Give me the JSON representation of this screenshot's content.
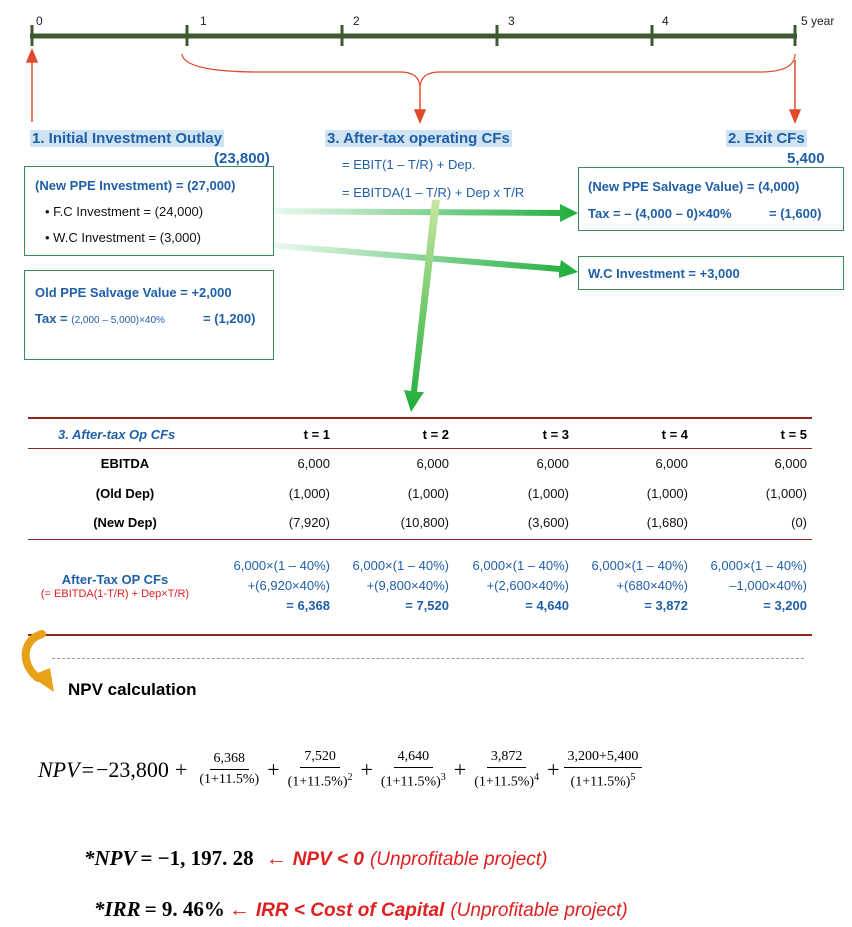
{
  "timeline": {
    "ticks": [
      "0",
      "1",
      "2",
      "3",
      "4",
      "5 year"
    ]
  },
  "initial": {
    "title": "1. Initial Investment Outlay",
    "amount": "(23,800)",
    "box1": {
      "line1": "(New PPE Investment) = (27,000)",
      "bullet1": "F.C Investment = (24,000)",
      "bullet2": "W.C Investment = (3,000)"
    },
    "box2": {
      "line1": "Old PPE Salvage Value = +2,000",
      "tax_label": "Tax = ",
      "tax_formula": "(2,000 – 5,000)×40%",
      "tax_value": "= (1,200)"
    }
  },
  "operating": {
    "title": "3. After-tax operating CFs",
    "formula1": "= EBIT(1 – T/R) + Dep.",
    "formula2": "= EBITDA(1 – T/R) + Dep x T/R"
  },
  "exit": {
    "title": "2. Exit CFs",
    "amount": "5,400",
    "box1": {
      "line1": "(New PPE Salvage Value) = (4,000)",
      "tax_label": "Tax = – (4,000 – 0)×40%",
      "tax_value": "= (1,600)"
    },
    "box2": {
      "line1": "W.C Investment = +3,000"
    }
  },
  "table": {
    "title": "3. After-tax Op CFs",
    "headers": [
      "t = 1",
      "t = 2",
      "t = 3",
      "t = 4",
      "t = 5"
    ],
    "rows": [
      {
        "label": "EBITDA",
        "values": [
          "6,000",
          "6,000",
          "6,000",
          "6,000",
          "6,000"
        ]
      },
      {
        "label": "(Old Dep)",
        "values": [
          "(1,000)",
          "(1,000)",
          "(1,000)",
          "(1,000)",
          "(1,000)"
        ]
      },
      {
        "label": "(New Dep)",
        "values": [
          "(7,920)",
          "(10,800)",
          "(3,600)",
          "(1,680)",
          "(0)"
        ]
      }
    ],
    "cf_label": "After-Tax OP CFs",
    "cf_sublabel": "(= EBITDA(1-T/R) + Dep×T/R)",
    "cf_calcs": [
      {
        "l1": "6,000×(1 – 40%)",
        "l2": "+(6,920×40%)",
        "l3": "= 6,368"
      },
      {
        "l1": "6,000×(1 – 40%)",
        "l2": "+(9,800×40%)",
        "l3": "= 7,520"
      },
      {
        "l1": "6,000×(1 – 40%)",
        "l2": "+(2,600×40%)",
        "l3": "= 4,640"
      },
      {
        "l1": "6,000×(1 – 40%)",
        "l2": "+(680×40%)",
        "l3": "= 3,872"
      },
      {
        "l1": "6,000×(1 – 40%)",
        "l2": "–1,000×40%)",
        "l3": "= 3,200"
      }
    ]
  },
  "npv": {
    "heading": "NPV calculation",
    "lhs": "NPV",
    "eq": "=",
    "initial": "−23,800",
    "plus": "+",
    "terms": [
      {
        "num": "6,368",
        "den": "(1+11.5%)",
        "exp": ""
      },
      {
        "num": "7,520",
        "den": "(1+11.5%)",
        "exp": "2"
      },
      {
        "num": "4,640",
        "den": "(1+11.5%)",
        "exp": "3"
      },
      {
        "num": "3,872",
        "den": "(1+11.5%)",
        "exp": "4"
      },
      {
        "num": "3,200+5,400",
        "den": "(1+11.5%)",
        "exp": "5"
      }
    ]
  },
  "results": {
    "npv_lhs": "*NPV",
    "npv_val": "= −1, 197. 28",
    "npv_arrow": "←",
    "npv_cond": "NPV < 0",
    "npv_note": "(Unprofitable project)",
    "irr_lhs": "*IRR",
    "irr_val": "= 9. 46%",
    "irr_arrow": "←",
    "irr_cond": "IRR < Cost of Capital",
    "irr_note": "(Unprofitable project)"
  },
  "colors": {
    "timeline": "#3d5a2e",
    "accent_blue": "#1f5fa8",
    "red": "#e02020",
    "green_arrow": "#2db34a",
    "box_border": "#3a8a5a"
  }
}
